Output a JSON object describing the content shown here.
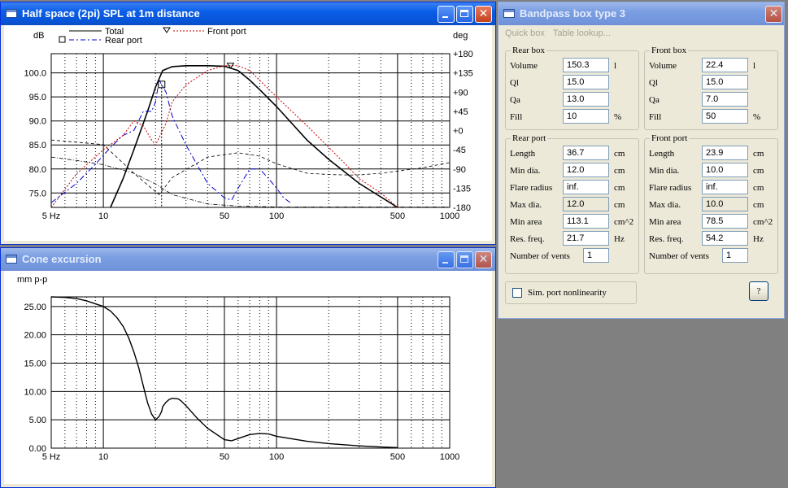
{
  "spl": {
    "title": "Half space (2pi) SPL at 1m distance",
    "left_unit": "dB",
    "right_unit": "deg",
    "legend": {
      "total": "Total",
      "rear": "Rear port",
      "front": "Front port"
    },
    "y_ticks": [
      "100.0",
      "95.0",
      "90.0",
      "85.0",
      "80.0",
      "75.0"
    ],
    "y_values": [
      100,
      95,
      90,
      85,
      80,
      75
    ],
    "phase_ticks": [
      "+180",
      "+135",
      "+90",
      "+45",
      "+0",
      "-45",
      "-90",
      "-135",
      "-180"
    ],
    "phase_values": [
      180,
      135,
      90,
      45,
      0,
      -45,
      -90,
      -135,
      -180
    ],
    "x_labels": [
      "5 Hz",
      "10",
      "50",
      "100",
      "500",
      "1000"
    ],
    "x_values": [
      5,
      10,
      50,
      100,
      500,
      1000
    ],
    "colors": {
      "total": "#000000",
      "rear": "#0000c8",
      "front": "#c80000",
      "phase": "#000000"
    }
  },
  "cone": {
    "title": "Cone excursion",
    "unit": "mm p-p",
    "y_ticks": [
      "25.00",
      "20.00",
      "15.00",
      "10.00",
      "5.00",
      "0.00"
    ],
    "y_values": [
      25,
      20,
      15,
      10,
      5,
      0
    ],
    "x_labels": [
      "5 Hz",
      "10",
      "50",
      "100",
      "500",
      "1000"
    ],
    "x_values": [
      5,
      10,
      50,
      100,
      500,
      1000
    ]
  },
  "chart_data": [
    {
      "type": "line",
      "title": "Half space (2pi) SPL at 1m distance",
      "xlabel": "",
      "ylabel": "dB",
      "y2label": "deg",
      "xscale": "log",
      "xlim": [
        5,
        1000
      ],
      "ylim": [
        72,
        104
      ],
      "y2lim": [
        -180,
        180
      ],
      "grid": true,
      "legend_position": "top-left",
      "series": [
        {
          "name": "Total",
          "axis": "left",
          "x": [
            11,
            13,
            15,
            18,
            20,
            22,
            25,
            30,
            40,
            50,
            60,
            70,
            80,
            100,
            150,
            200,
            300,
            500
          ],
          "y": [
            72,
            78,
            84,
            92,
            97,
            100.5,
            101.3,
            101.5,
            101.5,
            101.4,
            100.5,
            98.5,
            96.5,
            93,
            86,
            82,
            77,
            72
          ]
        },
        {
          "name": "Rear port",
          "axis": "left",
          "x": [
            5,
            7,
            9,
            11,
            13,
            15,
            17,
            19,
            20,
            21,
            23,
            25,
            30,
            40,
            50,
            55,
            60,
            70,
            80,
            90,
            100,
            110,
            120
          ],
          "y": [
            73,
            77,
            81,
            84.5,
            87,
            88,
            92,
            92,
            94,
            98.5,
            96,
            91,
            85,
            77,
            74,
            73.5,
            76,
            80,
            80,
            78,
            76,
            74,
            73
          ]
        },
        {
          "name": "Front port",
          "axis": "left",
          "x": [
            5,
            7,
            10,
            13,
            15,
            17,
            19,
            20,
            21,
            23,
            25,
            30,
            40,
            50,
            60,
            70,
            100,
            150,
            200,
            250,
            300,
            400,
            500
          ],
          "y": [
            72,
            79,
            84,
            87,
            90,
            89,
            86,
            85,
            86.5,
            89.5,
            94,
            97.5,
            100.5,
            101.5,
            101.5,
            100.5,
            95,
            89,
            84.5,
            81,
            78,
            75,
            72
          ]
        },
        {
          "name": "",
          "axis": "right",
          "x": [
            5,
            10,
            15,
            20,
            21,
            25,
            40,
            60,
            80,
            100,
            150,
            200,
            250,
            300,
            400,
            500,
            700,
            1000
          ],
          "y": [
            -22,
            -33,
            -100,
            -143,
            -150,
            -110,
            -62,
            -52,
            -60,
            -78,
            -100,
            -103,
            -104,
            -104,
            -100,
            -95,
            -87,
            -75
          ]
        },
        {
          "name": "",
          "axis": "right",
          "x": [
            5,
            7,
            10,
            15,
            20,
            25,
            40,
            60,
            80,
            100,
            150,
            200,
            300,
            400,
            500,
            700,
            1000
          ],
          "y": [
            -62,
            -70,
            -80,
            -100,
            -125,
            -150,
            -172,
            -177,
            -178,
            -179,
            -179,
            -179,
            -179,
            -179,
            -179,
            -179,
            -179
          ]
        }
      ],
      "markers": [
        {
          "series": "Rear port",
          "shape": "square",
          "x": 21.7
        },
        {
          "series": "Front port",
          "shape": "triangle",
          "x": 54.2
        }
      ]
    },
    {
      "type": "line",
      "title": "Cone excursion",
      "xlabel": "",
      "ylabel": "mm p-p",
      "xscale": "log",
      "xlim": [
        5,
        1000
      ],
      "ylim": [
        0,
        26.7
      ],
      "grid": true,
      "series": [
        {
          "name": "",
          "x": [
            5,
            6,
            7,
            8,
            10,
            11,
            12,
            13,
            14,
            15,
            16,
            17,
            18,
            19,
            20,
            21,
            21.7,
            22,
            23,
            24,
            25,
            27,
            28,
            30,
            35,
            40,
            50,
            55,
            60,
            70,
            80,
            90,
            100,
            150,
            200,
            300,
            400,
            500
          ],
          "y": [
            26.7,
            26.6,
            26.4,
            26,
            25,
            24.2,
            23,
            21.5,
            19.5,
            17,
            14.2,
            11,
            8,
            6,
            5,
            5.6,
            6.5,
            7.3,
            8.1,
            8.6,
            8.8,
            8.7,
            8.4,
            7.5,
            5.2,
            3.5,
            1.5,
            1.3,
            1.7,
            2.4,
            2.6,
            2.5,
            2.1,
            1.2,
            0.8,
            0.4,
            0.2,
            0.1
          ]
        }
      ]
    }
  ],
  "bandpass": {
    "title": "Bandpass box type 3",
    "menu": [
      "Quick box",
      "Table lookup..."
    ],
    "rear_box": {
      "legend": "Rear box",
      "rows": [
        {
          "label": "Volume",
          "value": "150.3",
          "unit": "l"
        },
        {
          "label": "Ql",
          "value": "15.0",
          "unit": ""
        },
        {
          "label": "Qa",
          "value": "13.0",
          "unit": ""
        },
        {
          "label": "Fill",
          "value": "10",
          "unit": "%"
        }
      ]
    },
    "front_box": {
      "legend": "Front box",
      "rows": [
        {
          "label": "Volume",
          "value": "22.4",
          "unit": "l"
        },
        {
          "label": "Ql",
          "value": "15.0",
          "unit": ""
        },
        {
          "label": "Qa",
          "value": "7.0",
          "unit": ""
        },
        {
          "label": "Fill",
          "value": "50",
          "unit": "%"
        }
      ]
    },
    "rear_port": {
      "legend": "Rear port",
      "rows": [
        {
          "label": "Length",
          "value": "36.7",
          "unit": "cm",
          "ro": false
        },
        {
          "label": "Min dia.",
          "value": "12.0",
          "unit": "cm",
          "ro": false
        },
        {
          "label": "Flare radius",
          "value": "inf.",
          "unit": "cm",
          "ro": false
        },
        {
          "label": "Max dia.",
          "value": "12.0",
          "unit": "cm",
          "ro": true
        },
        {
          "label": "Min area",
          "value": "113.1",
          "unit": "cm^2",
          "ro": false
        },
        {
          "label": "Res. freq.",
          "value": "21.7",
          "unit": "Hz",
          "ro": false
        }
      ],
      "vents_label": "Number of vents",
      "vents": "1"
    },
    "front_port": {
      "legend": "Front port",
      "rows": [
        {
          "label": "Length",
          "value": "23.9",
          "unit": "cm",
          "ro": false
        },
        {
          "label": "Min dia.",
          "value": "10.0",
          "unit": "cm",
          "ro": false
        },
        {
          "label": "Flare radius",
          "value": "inf.",
          "unit": "cm",
          "ro": false
        },
        {
          "label": "Max dia.",
          "value": "10.0",
          "unit": "cm",
          "ro": true
        },
        {
          "label": "Min area",
          "value": "78.5",
          "unit": "cm^2",
          "ro": false
        },
        {
          "label": "Res. freq.",
          "value": "54.2",
          "unit": "Hz",
          "ro": false
        }
      ],
      "vents_label": "Number of vents",
      "vents": "1"
    },
    "sim_label": "Sim. port nonlinearity",
    "help": "?"
  }
}
